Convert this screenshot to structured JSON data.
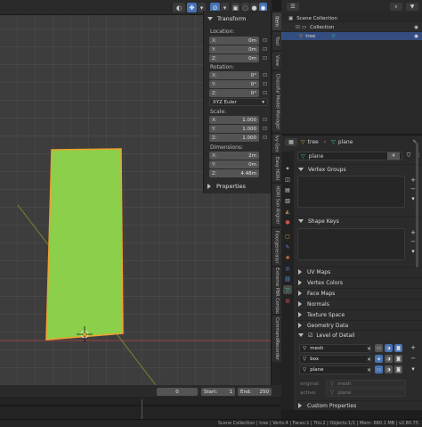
{
  "npanel": {
    "header": "Transform",
    "location_label": "Location:",
    "location": [
      {
        "axis": "X:",
        "value": "0m"
      },
      {
        "axis": "Y:",
        "value": "0m"
      },
      {
        "axis": "Z:",
        "value": "0m"
      }
    ],
    "rotation_label": "Rotation:",
    "rotation": [
      {
        "axis": "X:",
        "value": "0°"
      },
      {
        "axis": "Y:",
        "value": "0°"
      },
      {
        "axis": "Z:",
        "value": "0°"
      }
    ],
    "rotation_mode": "XYZ Euler",
    "scale_label": "Scale:",
    "scale": [
      {
        "axis": "X:",
        "value": "1.000"
      },
      {
        "axis": "Y:",
        "value": "1.000"
      },
      {
        "axis": "Z:",
        "value": "1.000"
      }
    ],
    "dimensions_label": "Dimensions:",
    "dimensions": [
      {
        "axis": "X:",
        "value": "2m"
      },
      {
        "axis": "Y:",
        "value": "0m"
      },
      {
        "axis": "Z:",
        "value": "4.48m"
      }
    ],
    "properties_header": "Properties"
  },
  "side_tabs": [
    "Item",
    "Tool",
    "View",
    "Chocofur Model Manager",
    "Ivy Gen",
    "Easy HDRI",
    "HDRI Sun Aligner",
    "Floorgenerator",
    "Extreme PBR Combo",
    "CommandRecorder"
  ],
  "outliner": {
    "rows": [
      {
        "name": "Scene Collection",
        "indent": 0
      },
      {
        "name": "Collection",
        "indent": 1
      },
      {
        "name": "tree",
        "indent": 1
      }
    ]
  },
  "properties": {
    "object_name": "tree",
    "data_name": "plane",
    "mesh_datablock": "plane",
    "users": "4",
    "sections": {
      "vertex_groups": "Vertex Groups",
      "shape_keys": "Shape Keys",
      "uv_maps": "UV Maps",
      "vertex_colors": "Vertex Colors",
      "face_maps": "Face Maps",
      "normals": "Normals",
      "texture_space": "Texture Space",
      "geometry_data": "Geometry Data",
      "level_of_detail": "Level of Detail",
      "custom_properties": "Custom Properties"
    },
    "lod_items": [
      "mesh",
      "box",
      "plane"
    ],
    "original_label": "original:",
    "original_value": "mesh",
    "active_label": "active:",
    "active_value": "plane"
  },
  "timeline": {
    "current_frame": "0",
    "start_label": "Start:",
    "start": "1",
    "end_label": "End:",
    "end": "250"
  },
  "status": {
    "text": "Scene Collection | tree | Verts:4 | Faces:1 | Tris:2 | Objects:1/1 | Mem: 680.1 MB | v2.80.75"
  },
  "colors": {
    "plane_fill": "#8bcf4a",
    "plane_outline": "#f0a030",
    "accent_blue": "#4772b3",
    "selection_row": "#334d80"
  }
}
